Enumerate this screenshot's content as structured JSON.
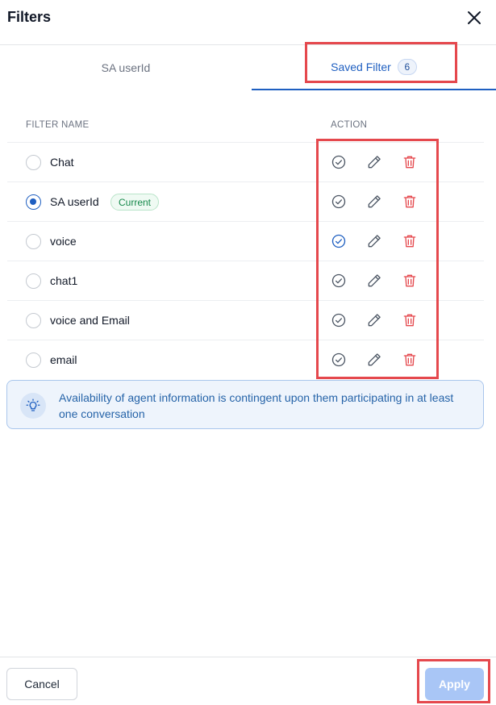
{
  "dialog": {
    "title": "Filters"
  },
  "tabs": [
    {
      "label": "SA userId",
      "active": false
    },
    {
      "label": "Saved Filter",
      "active": true,
      "count": "6"
    }
  ],
  "table": {
    "headers": {
      "name": "FILTER NAME",
      "action": "ACTION"
    },
    "rows": [
      {
        "label": "Chat",
        "selected": false,
        "badge": "",
        "check_state": "default"
      },
      {
        "label": "SA userId",
        "selected": true,
        "badge": "Current",
        "check_state": "default"
      },
      {
        "label": "voice",
        "selected": false,
        "badge": "",
        "check_state": "active"
      },
      {
        "label": "chat1",
        "selected": false,
        "badge": "",
        "check_state": "default"
      },
      {
        "label": "voice and Email",
        "selected": false,
        "badge": "",
        "check_state": "default"
      },
      {
        "label": "email",
        "selected": false,
        "badge": "",
        "check_state": "default"
      }
    ],
    "icons": {
      "check": "check-circle-icon",
      "edit": "pencil-icon",
      "delete": "trash-icon"
    }
  },
  "info": {
    "icon": "lightbulb-icon",
    "text": "Availability of agent information is contingent upon them participating in at least one conversation"
  },
  "footer": {
    "cancel_label": "Cancel",
    "apply_label": "Apply",
    "apply_enabled": false
  },
  "colors": {
    "accent": "#1f5fc1",
    "danger": "#e5484d",
    "success": "#16894b",
    "info_bg": "#eef4fc"
  }
}
